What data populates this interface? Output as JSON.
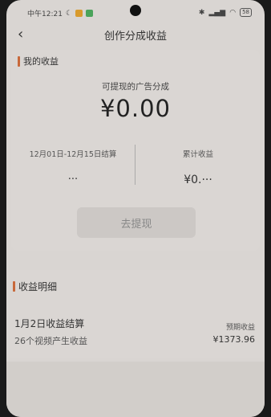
{
  "status": {
    "time": "中午12:21",
    "battery": "58"
  },
  "header": {
    "title": "创作分成收益"
  },
  "income": {
    "section_label": "我的收益",
    "withdrawable_label": "可提现的广告分成",
    "withdrawable_amount": "¥0.00",
    "period_label": "12月01日-12月15日结算",
    "period_value": "···",
    "total_label": "累计收益",
    "total_value": "¥0.···",
    "withdraw_button": "去提现"
  },
  "details": {
    "section_label": "收益明细",
    "items": [
      {
        "title": "1月2日收益结算",
        "subtitle": "26个视频产生收益",
        "expected_label": "预期收益",
        "expected_amount": "¥1373.96"
      }
    ]
  },
  "colors": {
    "accent": "#c8683a"
  }
}
